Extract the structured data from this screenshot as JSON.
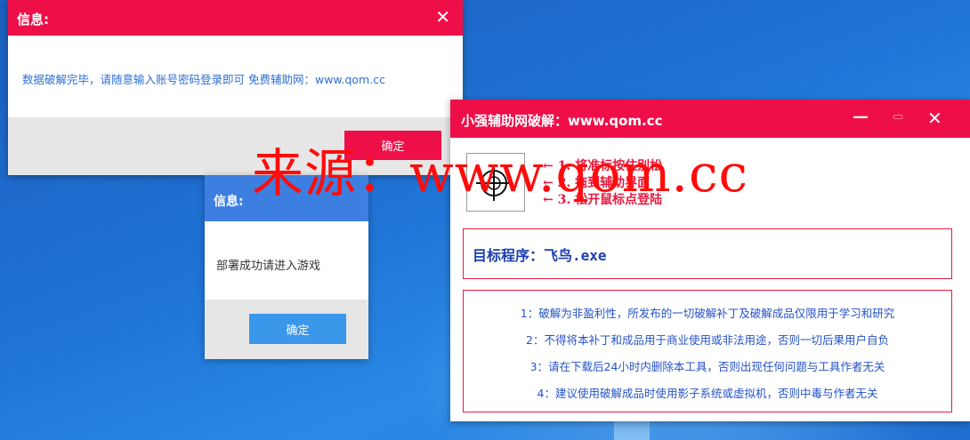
{
  "win1": {
    "title": "信息:",
    "close": "✕",
    "message": "数据破解完毕，请随意输入账号密码登录即可 免费辅助网：www.qom.cc",
    "ok_label": "确定"
  },
  "win2": {
    "title": "信息:",
    "message": "部署成功请进入游戏",
    "ok_label": "确定"
  },
  "win3": {
    "title": "小强辅助网破解：www.qom.cc",
    "controls": {
      "minimize": "—",
      "maximize": "▭",
      "close": "✕"
    },
    "steps": [
      "← 1. 将准标按住别松",
      "← 2. 拖到辅助界面",
      "← 3. 松开鼠标点登陆"
    ],
    "program_label": "目标程序：飞鸟.exe",
    "notes": [
      "1：破解为非盈利性，所发布的一切破解补丁及破解成品仅限用于学习和研究",
      "2：不得将本补丁和成品用于商业使用或非法用途，否则一切后果用户自负",
      "3：请在下载后24小时内删除本工具，否则出现任何问题与工具作者无关",
      "4：建议使用破解成品时使用影子系统或虚拟机，否则中毒与作者无关"
    ]
  },
  "watermark": "来源：www.qom.cc",
  "colors": {
    "red": "#ee0f49",
    "blue": "#3d7fe0",
    "button_blue": "#3a97ea",
    "note_text": "#2453c8"
  },
  "icons": {
    "target": "crosshair-icon"
  }
}
